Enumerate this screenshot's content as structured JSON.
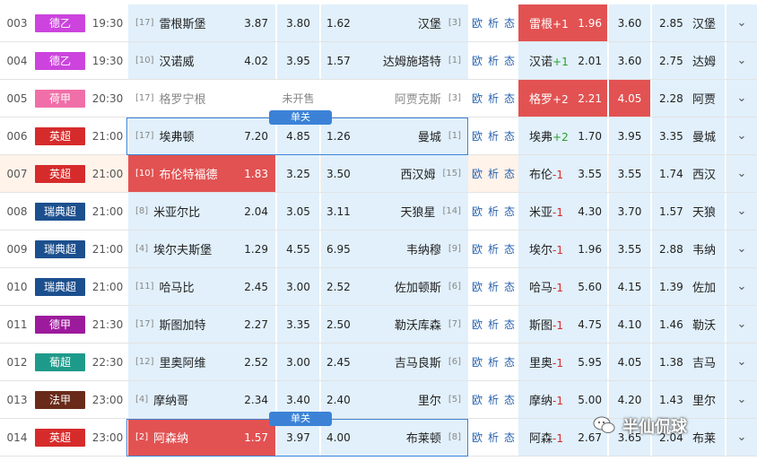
{
  "colors": {
    "de2": "#cc44dd",
    "de1": "#9c1a9c",
    "nl": "#f06fa8",
    "en": "#d62b2b",
    "se": "#1c4f8e",
    "pt": "#1e9a8a",
    "fr": "#6a2a1a",
    "cell_bg": "#e1f0fb",
    "win": "#e25252"
  },
  "rows": [
    {
      "no": "003",
      "league": "德乙",
      "lc": "#cc44dd",
      "time": "19:30",
      "hr": "[17]",
      "home": "雷根斯堡",
      "o1": "3.87",
      "o2": "3.80",
      "o3": "1.62",
      "away": "汉堡",
      "ar": "[3]",
      "links": [
        "欧",
        "析",
        "态"
      ],
      "h2": "雷根+1",
      "h2s": "+",
      "h2sign": "+1",
      "h2name": "雷根",
      "h2o": "1.96",
      "d2": "3.60",
      "a2o": "2.85",
      "a2": "汉堡"
    },
    {
      "no": "004",
      "league": "德乙",
      "lc": "#cc44dd",
      "time": "19:30",
      "hr": "[10]",
      "home": "汉诺威",
      "o1": "4.02",
      "o2": "3.95",
      "o3": "1.57",
      "away": "达姆施塔特",
      "ar": "[1]",
      "links": [
        "欧",
        "析",
        "态"
      ],
      "h2name": "汉诺",
      "h2sign": "+1",
      "h2o": "2.01",
      "d2": "3.60",
      "a2o": "2.75",
      "a2": "达姆"
    },
    {
      "no": "005",
      "league": "荷甲",
      "lc": "#f06fa8",
      "time": "20:30",
      "hr": "[17]",
      "home": "格罗宁根",
      "o1": "",
      "o2": "未开售",
      "o3": "",
      "away": "阿贾克斯",
      "ar": "[3]",
      "links": [
        "欧",
        "析",
        "态"
      ],
      "h2name": "格罗",
      "h2sign": "+2",
      "h2o": "2.21",
      "d2": "4.05",
      "a2o": "2.28",
      "a2": "阿贾"
    },
    {
      "no": "006",
      "league": "英超",
      "lc": "#d62b2b",
      "time": "21:00",
      "hr": "[17]",
      "home": "埃弗顿",
      "o1": "7.20",
      "o2": "4.85",
      "o3": "1.26",
      "away": "曼城",
      "ar": "[1]",
      "links": [
        "欧",
        "析",
        "态"
      ],
      "h2name": "埃弗",
      "h2sign": "+2",
      "h2o": "1.70",
      "d2": "3.95",
      "a2o": "3.35",
      "a2": "曼城"
    },
    {
      "no": "007",
      "league": "英超",
      "lc": "#d62b2b",
      "time": "21:00",
      "hr": "[10]",
      "home": "布伦特福德",
      "o1": "1.83",
      "o2": "3.25",
      "o3": "3.50",
      "away": "西汉姆",
      "ar": "[15]",
      "links": [
        "欧",
        "析",
        "态"
      ],
      "h2name": "布伦",
      "h2sign": "-1",
      "h2o": "3.55",
      "d2": "3.55",
      "a2o": "1.74",
      "a2": "西汉"
    },
    {
      "no": "008",
      "league": "瑞典超",
      "lc": "#1c4f8e",
      "time": "21:00",
      "hr": "[8]",
      "home": "米亚尔比",
      "o1": "2.04",
      "o2": "3.05",
      "o3": "3.11",
      "away": "天狼星",
      "ar": "[14]",
      "links": [
        "欧",
        "析",
        "态"
      ],
      "h2name": "米亚",
      "h2sign": "-1",
      "h2o": "4.30",
      "d2": "3.70",
      "a2o": "1.57",
      "a2": "天狼"
    },
    {
      "no": "009",
      "league": "瑞典超",
      "lc": "#1c4f8e",
      "time": "21:00",
      "hr": "[4]",
      "home": "埃尔夫斯堡",
      "o1": "1.29",
      "o2": "4.55",
      "o3": "6.95",
      "away": "韦纳穆",
      "ar": "[9]",
      "links": [
        "欧",
        "析",
        "态"
      ],
      "h2name": "埃尔",
      "h2sign": "-1",
      "h2o": "1.96",
      "d2": "3.55",
      "a2o": "2.88",
      "a2": "韦纳"
    },
    {
      "no": "010",
      "league": "瑞典超",
      "lc": "#1c4f8e",
      "time": "21:00",
      "hr": "[11]",
      "home": "哈马比",
      "o1": "2.45",
      "o2": "3.00",
      "o3": "2.52",
      "away": "佐加顿斯",
      "ar": "[6]",
      "links": [
        "欧",
        "析",
        "态"
      ],
      "h2name": "哈马",
      "h2sign": "-1",
      "h2o": "5.60",
      "d2": "4.15",
      "a2o": "1.39",
      "a2": "佐加"
    },
    {
      "no": "011",
      "league": "德甲",
      "lc": "#9c1a9c",
      "time": "21:30",
      "hr": "[17]",
      "home": "斯图加特",
      "o1": "2.27",
      "o2": "3.35",
      "o3": "2.50",
      "away": "勒沃库森",
      "ar": "[7]",
      "links": [
        "欧",
        "析",
        "态"
      ],
      "h2name": "斯图",
      "h2sign": "-1",
      "h2o": "4.75",
      "d2": "4.10",
      "a2o": "1.46",
      "a2": "勒沃"
    },
    {
      "no": "012",
      "league": "葡超",
      "lc": "#1e9a8a",
      "time": "22:30",
      "hr": "[12]",
      "home": "里奥阿维",
      "o1": "2.52",
      "o2": "3.00",
      "o3": "2.45",
      "away": "吉马良斯",
      "ar": "[6]",
      "links": [
        "欧",
        "析",
        "态"
      ],
      "h2name": "里奥",
      "h2sign": "-1",
      "h2o": "5.95",
      "d2": "4.05",
      "a2o": "1.38",
      "a2": "吉马"
    },
    {
      "no": "013",
      "league": "法甲",
      "lc": "#6a2a1a",
      "time": "23:00",
      "hr": "[4]",
      "home": "摩纳哥",
      "o1": "2.34",
      "o2": "3.40",
      "o3": "2.40",
      "away": "里尔",
      "ar": "[5]",
      "links": [
        "欧",
        "析",
        "态"
      ],
      "h2name": "摩纳",
      "h2sign": "-1",
      "h2o": "5.00",
      "d2": "4.20",
      "a2o": "1.43",
      "a2": "里尔"
    },
    {
      "no": "014",
      "league": "英超",
      "lc": "#d62b2b",
      "time": "23:00",
      "hr": "[2]",
      "home": "阿森纳",
      "o1": "1.57",
      "o2": "3.97",
      "o3": "4.00",
      "away": "布莱顿",
      "ar": "[8]",
      "links": [
        "欧",
        "析",
        "态"
      ],
      "h2name": "阿森",
      "h2sign": "-1",
      "h2o": "2.67",
      "d2": "3.65",
      "a2o": "2.04",
      "a2": "布莱"
    }
  ],
  "single_label": "单关",
  "watermark": "半仙侃球",
  "expand_icon": "chevron-down-icon"
}
